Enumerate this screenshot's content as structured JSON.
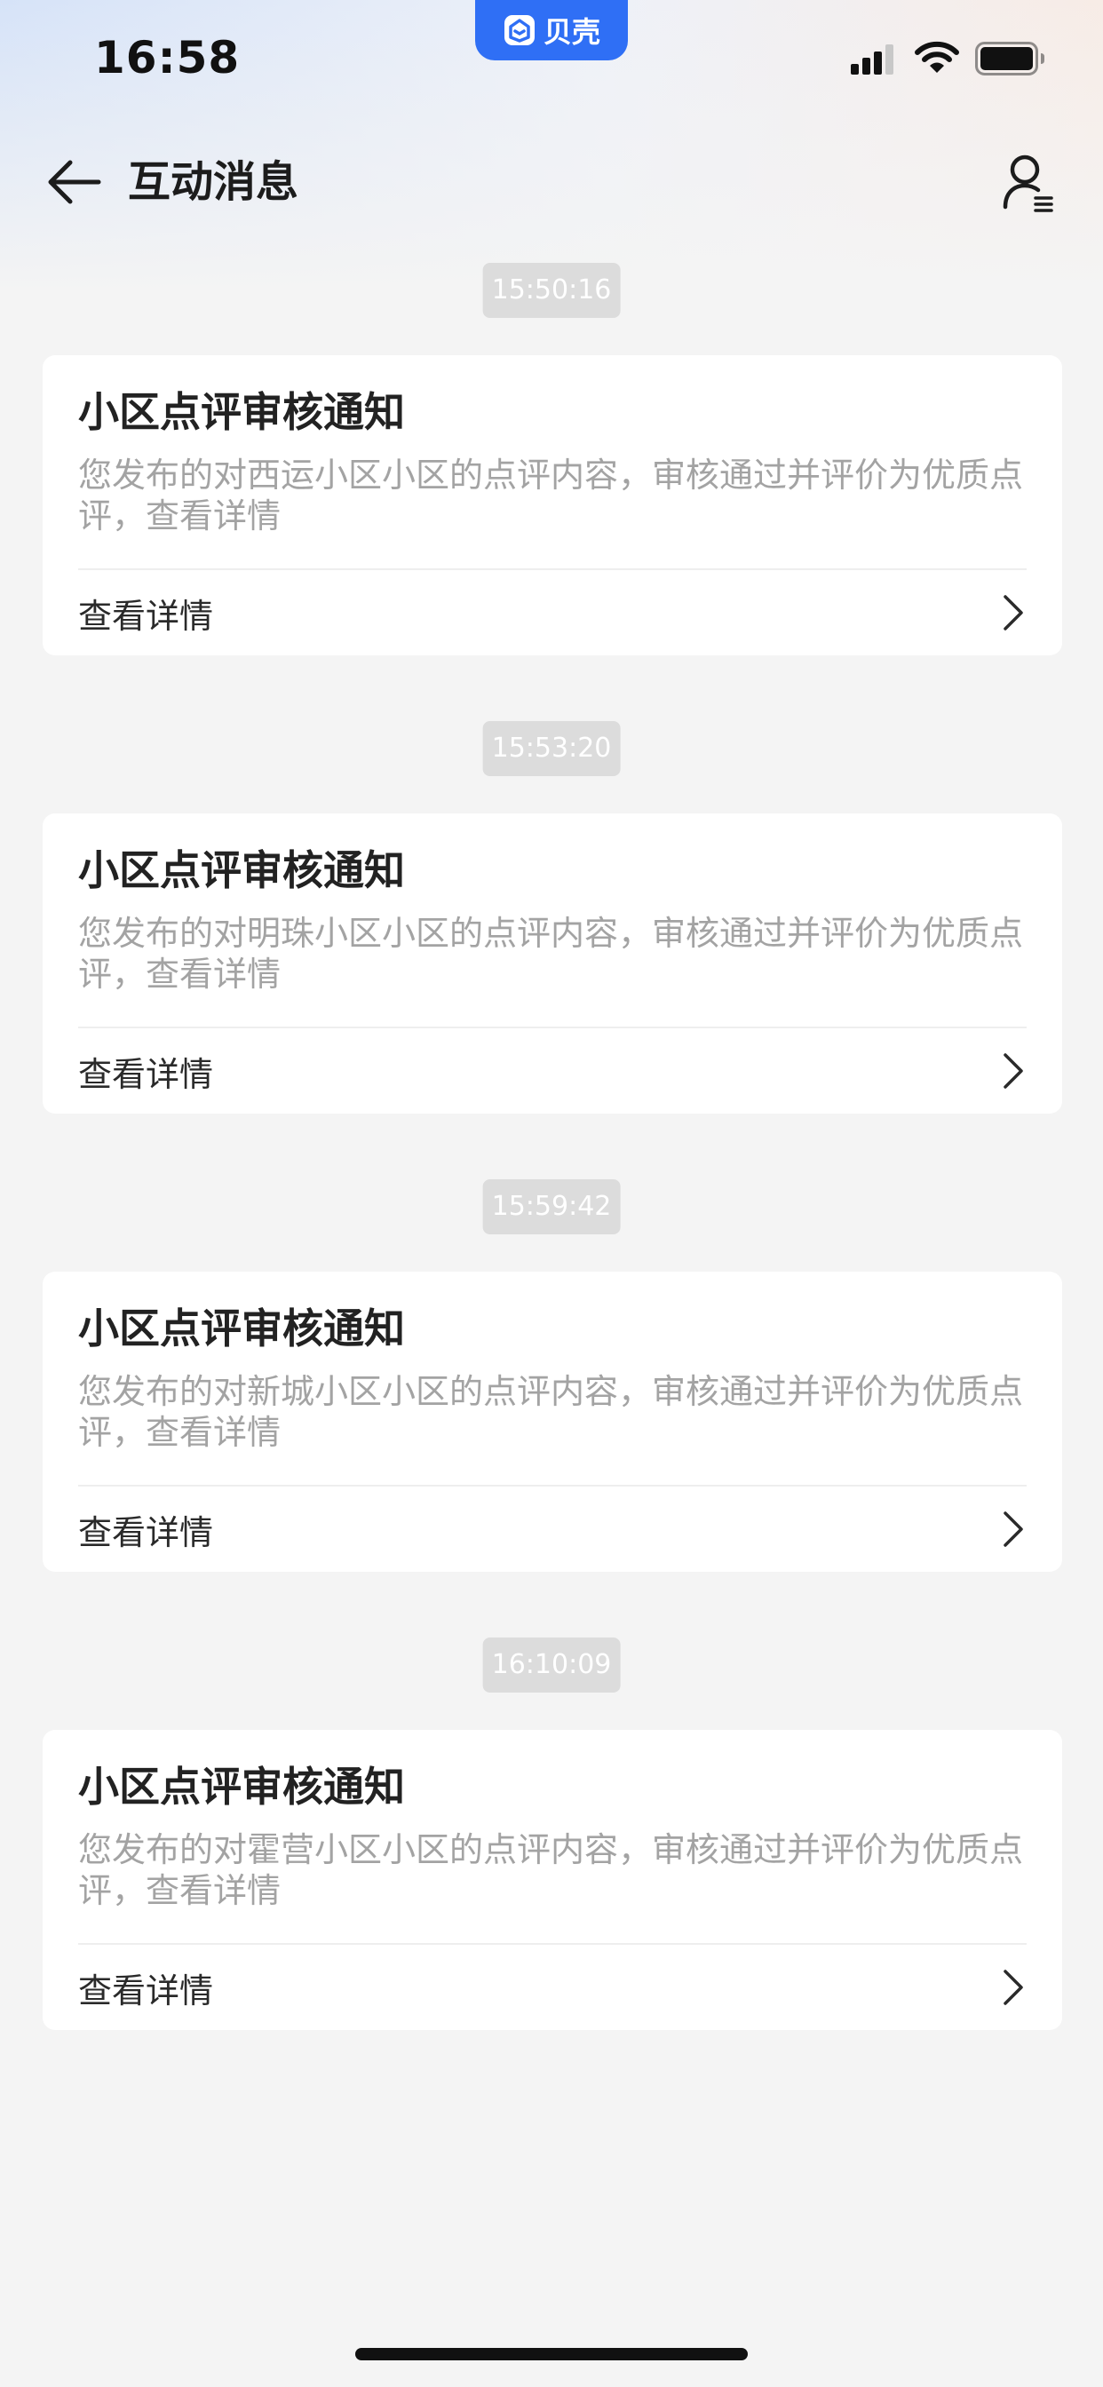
{
  "status_bar": {
    "time": "16:58",
    "app_badge": "贝壳"
  },
  "nav": {
    "title": "互动消息",
    "back_icon": "arrow-left-icon",
    "profile_icon": "user-settings-icon"
  },
  "messages": [
    {
      "time": "15:50:16",
      "title": "小区点评审核通知",
      "content": "您发布的对西运小区小区的点评内容，审核通过并评价为优质点评，查看详情",
      "link": "查看详情"
    },
    {
      "time": "15:53:20",
      "title": "小区点评审核通知",
      "content": "您发布的对明珠小区小区的点评内容，审核通过并评价为优质点评，查看详情",
      "link": "查看详情"
    },
    {
      "time": "15:59:42",
      "title": "小区点评审核通知",
      "content": "您发布的对新城小区小区的点评内容，审核通过并评价为优质点评，查看详情",
      "link": "查看详情"
    },
    {
      "time": "16:10:09",
      "title": "小区点评审核通知",
      "content": "您发布的对霍营小区小区的点评内容，审核通过并评价为优质点评，查看详情",
      "link": "查看详情"
    }
  ],
  "colors": {
    "app_accent": "#2f6ff5",
    "page_bg": "#f4f4f4",
    "card_bg": "#ffffff",
    "muted_text": "#a3a3a3",
    "time_badge_bg": "#dcdcdc"
  }
}
